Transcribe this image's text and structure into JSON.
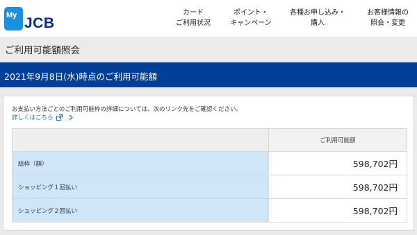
{
  "header": {
    "logo_my": "My",
    "logo_brand": "JCB",
    "nav": [
      {
        "label": "カード\nご利用状況"
      },
      {
        "label": "ポイント・\nキャンペーン"
      },
      {
        "label": "各種お申し込み・\n購入"
      },
      {
        "label": "お客様情報の\n照会・変更"
      }
    ]
  },
  "page_title": "ご利用可能額照会",
  "date_band": "2021年9月8日(水)時点のご利用可能額",
  "notice": "お支払い方法ごとのご利用可能枠の詳細については、次のリンク先をご確認ください。",
  "detail_link": "詳しくはこちら",
  "table": {
    "header": "ご利用可能額",
    "rows": [
      {
        "label": "総枠（額）",
        "value": "598,702円"
      },
      {
        "label": "ショッピング１回払い",
        "value": "598,702円"
      },
      {
        "label": "ショッピング２回払い",
        "value": "598,702円"
      }
    ]
  },
  "colors": {
    "brand_blue": "#003f98",
    "label_bg": "#cfe6f8",
    "link": "#1f6fc6"
  }
}
